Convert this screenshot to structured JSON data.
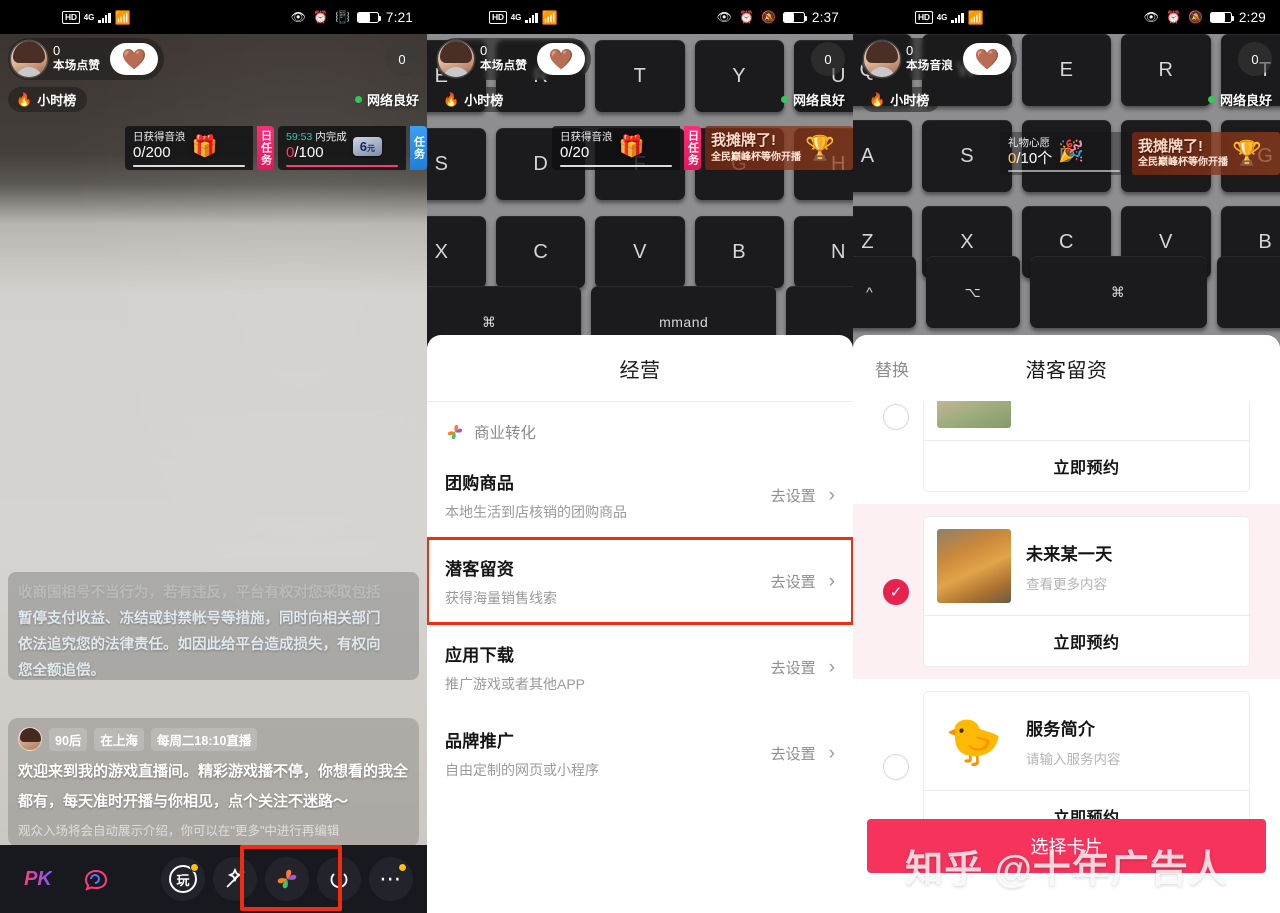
{
  "panels": [
    {
      "status": {
        "hd": "HD",
        "net_type": "4G",
        "time": "7:21"
      },
      "hud": {
        "like_count": "0",
        "like_label": "本场点赞",
        "gift_icon": "gift-heart-icon",
        "right_count": "0",
        "rank_label": "小时榜",
        "rank_icon": "flame-icon",
        "network_label": "网络良好",
        "tasks": [
          {
            "title": "日获得音浪",
            "value": "0/200",
            "icon": "red-packet-icon",
            "tab": "日任务"
          },
          {
            "title_prefix": "59:53",
            "title_suffix": " 内完成",
            "value_lead": "0",
            "value_rest": "/100",
            "chip": "6",
            "chip_unit": "元",
            "tab": "任务"
          }
        ]
      },
      "notice": {
        "faded_line": "收商国相号不当行为，若有违反，平台有权对您采取包括",
        "lines": [
          "暂停支付收益、冻结或封禁帐号等措施，同时向相关部门",
          "依法追究您的法律责任。如因此给平台造成损失，有权向",
          "您全额追偿。"
        ]
      },
      "intro": {
        "tags": [
          "90后",
          "在上海",
          "每周二18:10直播"
        ],
        "body": "欢迎来到我的游戏直播间。精彩游戏播不停，你想看的我全都有，每天准时开播与你相见，点个关注不迷路～",
        "hint": "观众入场将会自动展示介绍，你可以在\"更多\"中进行再编辑"
      },
      "toolbar": {
        "items": [
          {
            "name": "pk-icon",
            "label": "PK"
          },
          {
            "name": "chat-bubble-icon",
            "label": ""
          },
          {
            "name": "play-icon",
            "label": "玩"
          },
          {
            "name": "magic-wand-icon",
            "label": ""
          },
          {
            "name": "pinwheel-icon",
            "label": ""
          },
          {
            "name": "power-icon",
            "label": ""
          },
          {
            "name": "more-dots-icon",
            "label": ""
          }
        ]
      }
    },
    {
      "status": {
        "hd": "HD",
        "net_type": "4G",
        "time": "2:37"
      },
      "hud": {
        "like_count": "0",
        "like_label": "本场点赞",
        "right_count": "0",
        "rank_label": "小时榜",
        "network_label": "网络良好",
        "task": {
          "title": "日获得音浪",
          "value": "0/20",
          "icon": "gift-box-icon",
          "tab": "日任务"
        },
        "promo": {
          "line1": "我摊牌了!",
          "line2": "全民巅峰杯等你开播",
          "icon": "trophy-icon"
        }
      },
      "sheet": {
        "title": "经营",
        "category": {
          "icon": "pinwheel-icon",
          "label": "商业转化"
        },
        "items": [
          {
            "title": "团购商品",
            "subtitle": "本地生活到店核销的团购商品",
            "action": "去设置",
            "highlighted": false
          },
          {
            "title": "潜客留资",
            "subtitle": "获得海量销售线索",
            "action": "去设置",
            "highlighted": true
          },
          {
            "title": "应用下载",
            "subtitle": "推广游戏或者其他APP",
            "action": "去设置",
            "highlighted": false
          },
          {
            "title": "品牌推广",
            "subtitle": "自由定制的网页或小程序",
            "action": "去设置",
            "highlighted": false
          }
        ]
      }
    },
    {
      "status": {
        "hd": "HD",
        "net_type": "4G",
        "time": "2:29"
      },
      "hud": {
        "like_count": "0",
        "like_label": "本场音浪",
        "right_count": "0",
        "rank_label": "小时榜",
        "network_label": "网络良好",
        "task": {
          "title": "礼物心愿",
          "value_lead": "0",
          "value_rest": "/10个",
          "icon": "gift-card-icon"
        },
        "promo": {
          "line1": "我摊牌了!",
          "line2": "全民巅峰杯等你开播",
          "icon": "trophy-icon"
        }
      },
      "sheet": {
        "back_label": "替换",
        "title": "潜客留资",
        "cards": [
          {
            "title": "",
            "subtitle": "",
            "cta": "立即预约",
            "thumb": "flower-thumb",
            "selected": false,
            "partial": true
          },
          {
            "title": "未来某一天",
            "subtitle": "查看更多内容",
            "cta": "立即预约",
            "thumb": "tiger-thumb",
            "selected": true,
            "partial": false
          },
          {
            "title": "服务简介",
            "subtitle": "请输入服务内容",
            "cta": "立即预约",
            "thumb": "duck-thumb",
            "selected": false,
            "partial": false
          }
        ],
        "pick_button": "选择卡片"
      }
    }
  ],
  "watermark": "知乎 @十年广告人",
  "colors": {
    "accent_pink": "#f5335b",
    "selected_red": "#e8224f",
    "highlight_red": "#f02d10",
    "network_green": "#2ecc55",
    "task_blue": "#3aa0f5"
  }
}
